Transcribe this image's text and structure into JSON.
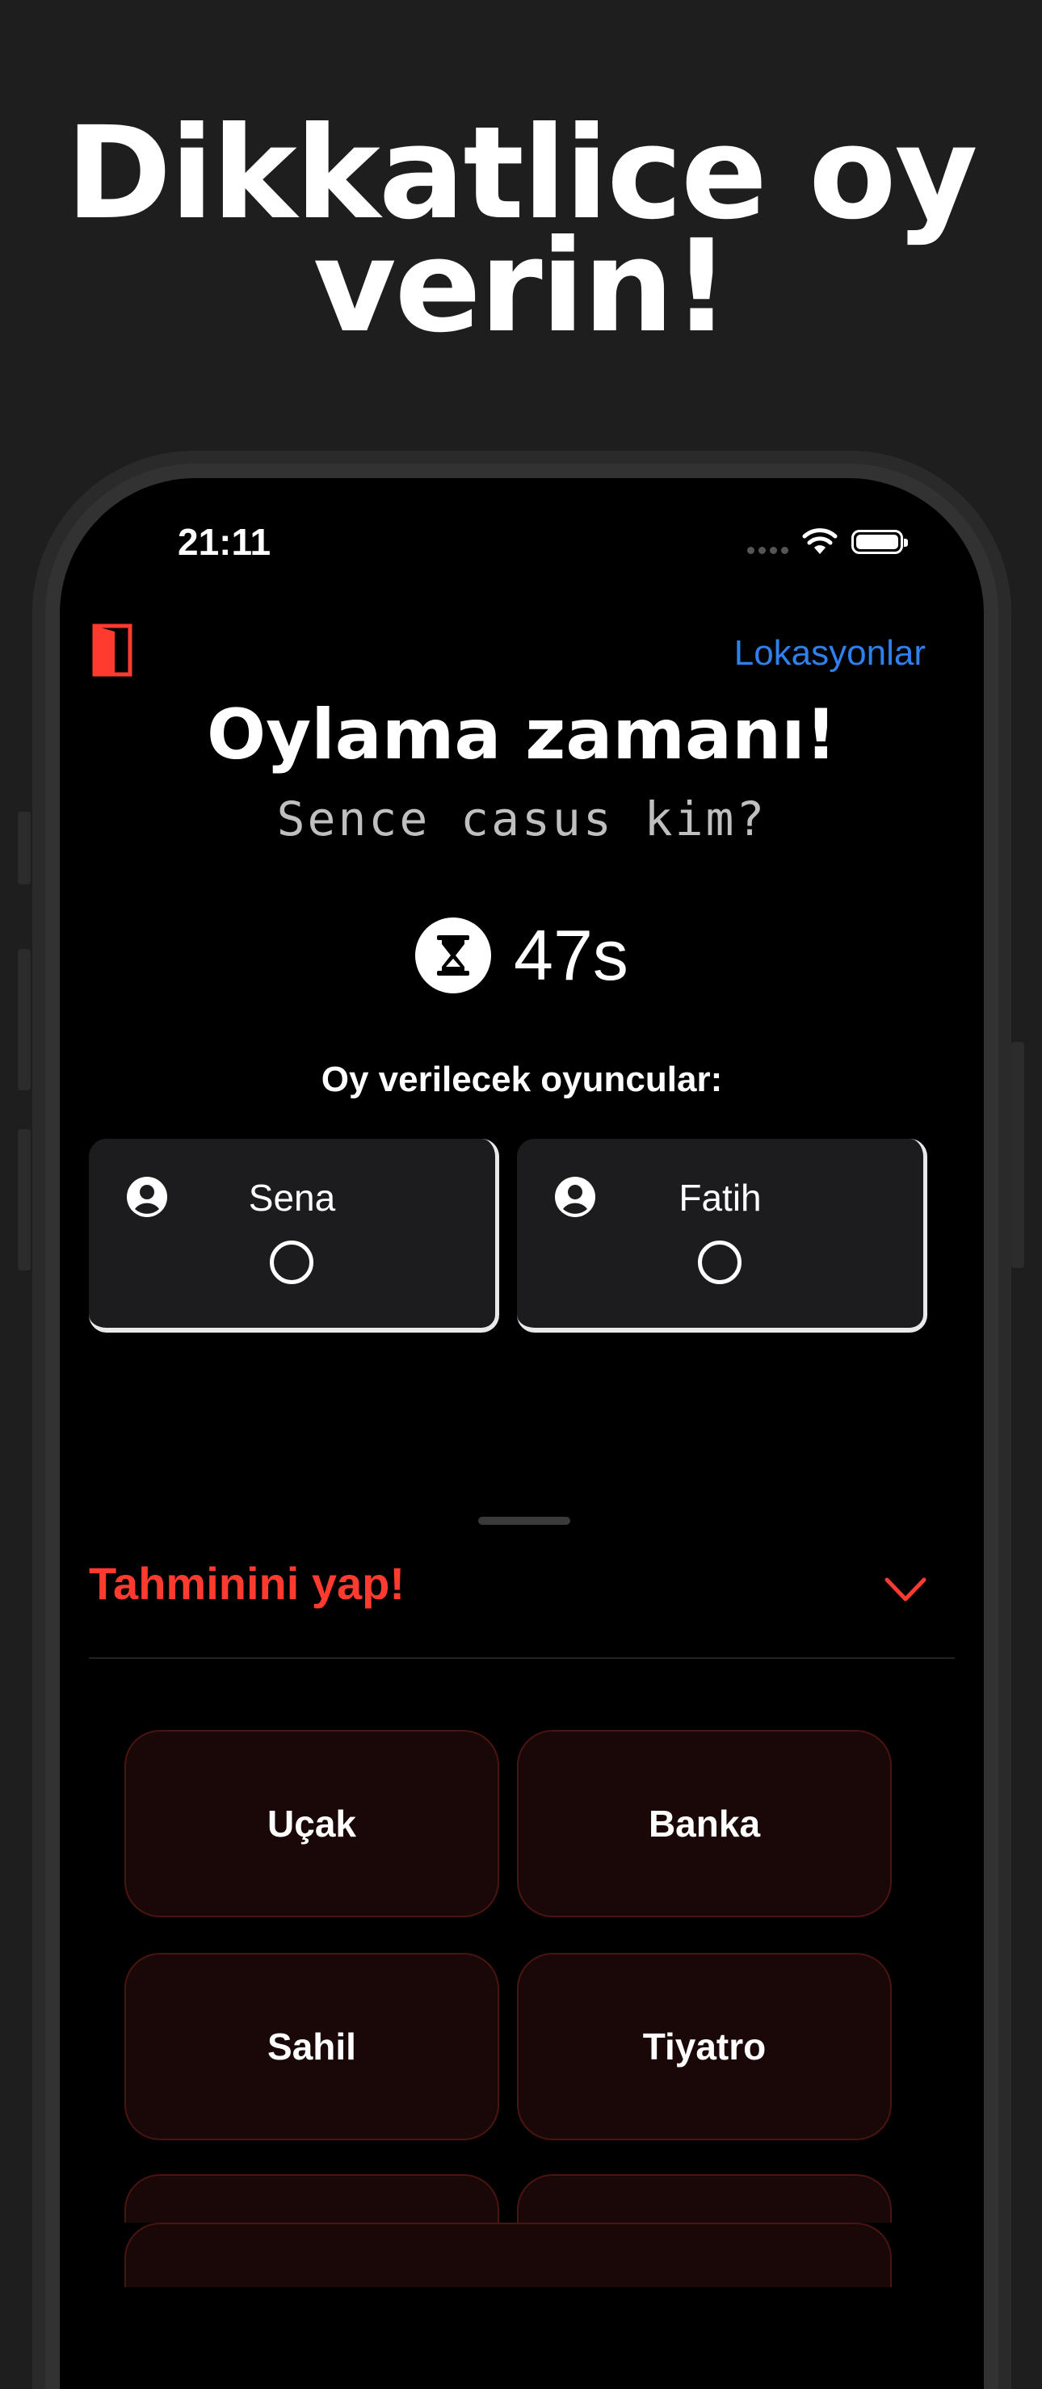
{
  "promo": {
    "line1": "Dikkatlice oy",
    "line2": "verin!"
  },
  "status_bar": {
    "time": "21:11"
  },
  "nav": {
    "right_link": "Lokasyonlar",
    "left_icon": "exit-door-icon"
  },
  "header": {
    "title": "Oylama zamanı!",
    "subtitle": "Sence casus kim?"
  },
  "timer": {
    "icon": "hourglass-icon",
    "text": "47s"
  },
  "players": {
    "label": "Oy verilecek oyuncular:",
    "items": [
      {
        "name": "Sena"
      },
      {
        "name": "Fatih"
      }
    ]
  },
  "guess": {
    "title": "Tahminini yap!",
    "locations": [
      "Uçak",
      "Banka",
      "Sahil",
      "Tiyatro"
    ]
  },
  "colors": {
    "accent_red": "#ff3b30",
    "link_blue": "#2f80ed",
    "background": "#000000"
  }
}
